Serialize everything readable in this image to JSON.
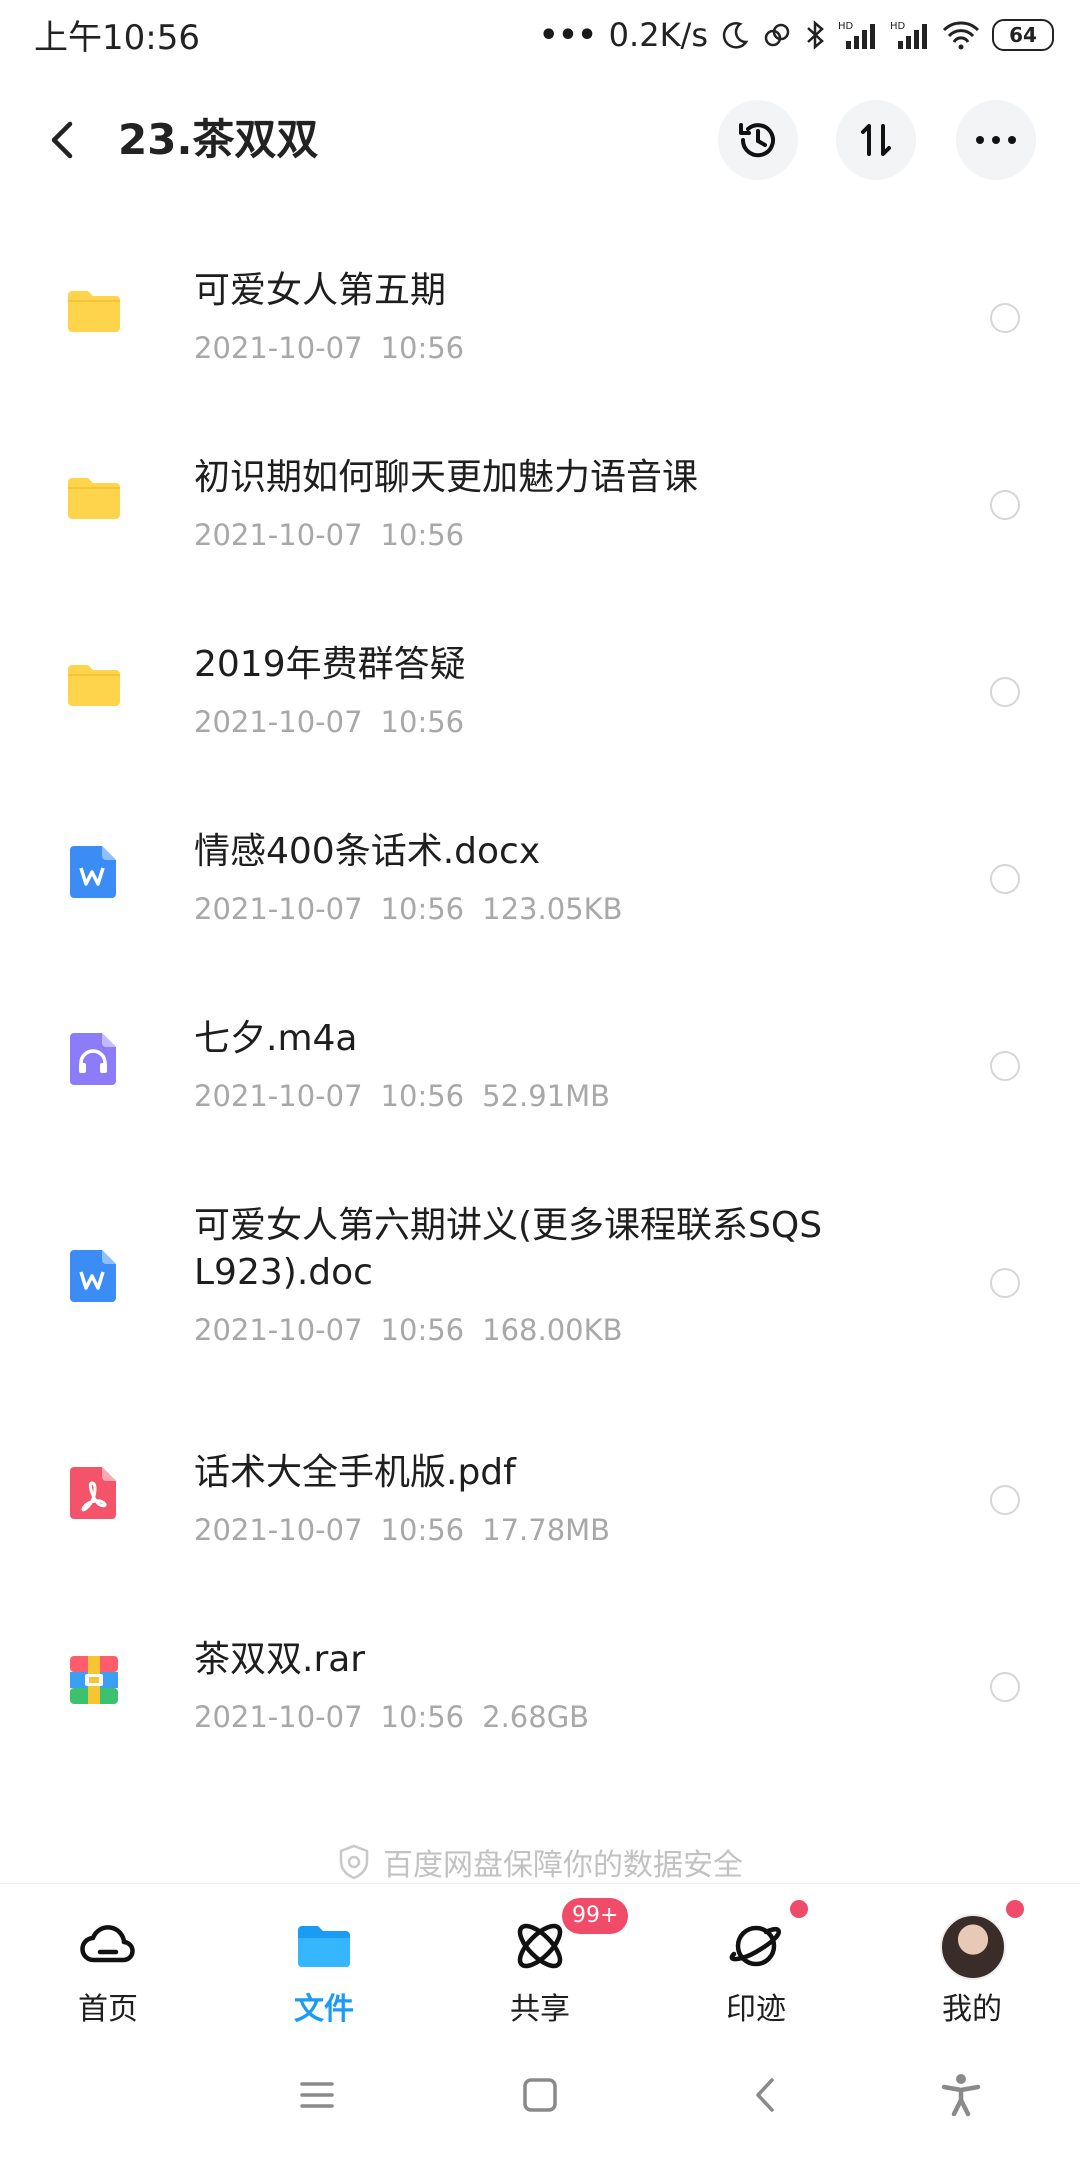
{
  "status_bar": {
    "time": "上午10:56",
    "net_speed": "0.2K/s",
    "battery": "64"
  },
  "header": {
    "title": "23.茶双双"
  },
  "files": [
    {
      "name": "可爱女人第五期",
      "date": "2021-10-07",
      "time": "10:56",
      "size": "",
      "type": "folder"
    },
    {
      "name": "初识期如何聊天更加魅力语音课",
      "date": "2021-10-07",
      "time": "10:56",
      "size": "",
      "type": "folder"
    },
    {
      "name": "2019年费群答疑",
      "date": "2021-10-07",
      "time": "10:56",
      "size": "",
      "type": "folder"
    },
    {
      "name": "情感400条话术.docx",
      "date": "2021-10-07",
      "time": "10:56",
      "size": "123.05KB",
      "type": "word"
    },
    {
      "name": "七夕.m4a",
      "date": "2021-10-07",
      "time": "10:56",
      "size": "52.91MB",
      "type": "audio"
    },
    {
      "name": "可爱女人第六期讲义(更多课程联系SQSL923).doc",
      "date": "2021-10-07",
      "time": "10:56",
      "size": "168.00KB",
      "type": "word"
    },
    {
      "name": "话术大全手机版.pdf",
      "date": "2021-10-07",
      "time": "10:56",
      "size": "17.78MB",
      "type": "pdf"
    },
    {
      "name": "茶双双.rar",
      "date": "2021-10-07",
      "time": "10:56",
      "size": "2.68GB",
      "type": "archive"
    }
  ],
  "security_note": "百度网盘保障你的数据安全",
  "tabs": [
    {
      "label": "首页",
      "icon": "cloud-icon"
    },
    {
      "label": "文件",
      "icon": "folder-icon"
    },
    {
      "label": "共享",
      "icon": "share-orbit-icon"
    },
    {
      "label": "印迹",
      "icon": "planet-icon"
    },
    {
      "label": "我的",
      "icon": "avatar"
    }
  ],
  "share_badge": "99+",
  "colors": {
    "active_tab": "#1a9cf5",
    "folder": "#ffd44d",
    "word": "#3b8cf5",
    "audio": "#8c7cf7",
    "pdf": "#f4546a",
    "badge": "#f14b6a"
  }
}
